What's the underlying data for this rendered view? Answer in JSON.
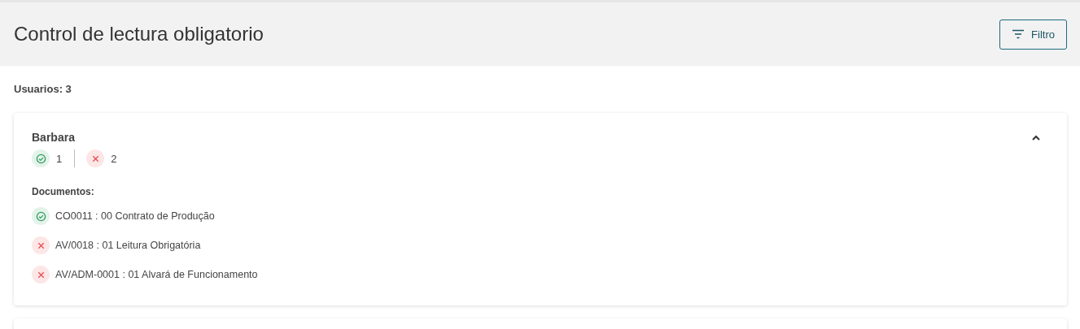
{
  "header": {
    "title": "Control de lectura obligatorio",
    "filter_button": "Filtro"
  },
  "users_count": "Usuarios: 3",
  "users": [
    {
      "name": "Barbara",
      "expanded": true,
      "read_count": "1",
      "unread_count": "2",
      "documents_label": "Documentos:",
      "documents": [
        {
          "label": "CO0011 : 00 Contrato de Produção",
          "read": true
        },
        {
          "label": "AV/0018 : 01 Leitura Obrigatória",
          "read": false
        },
        {
          "label": "AV/ADM-0001 : 01 Alvará de Funcionamento",
          "read": false
        }
      ]
    },
    {
      "partial": true
    }
  ]
}
